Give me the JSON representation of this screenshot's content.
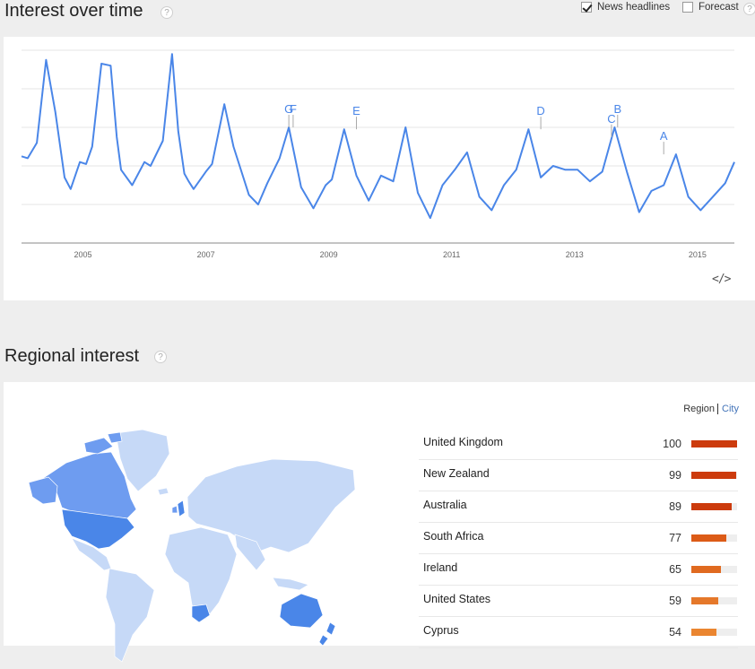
{
  "interest": {
    "title": "Interest over time",
    "help_icon": "?",
    "news_label": "News headlines",
    "news_checked": true,
    "forecast_label": "Forecast",
    "forecast_checked": false,
    "embed_icon": "</>"
  },
  "chart_data": {
    "type": "line",
    "x_ticks": [
      "2005",
      "2007",
      "2009",
      "2011",
      "2013",
      "2015"
    ],
    "x_range": [
      2004.0,
      2015.6
    ],
    "y_range": [
      0,
      100
    ],
    "grid": true,
    "series_color": "#4a86e8",
    "x": [
      2004.0,
      2004.1,
      2004.25,
      2004.4,
      2004.55,
      2004.7,
      2004.8,
      2004.95,
      2005.05,
      2005.15,
      2005.3,
      2005.45,
      2005.55,
      2005.62,
      2005.8,
      2006.0,
      2006.1,
      2006.3,
      2006.45,
      2006.55,
      2006.65,
      2006.72,
      2006.8,
      2007.0,
      2007.1,
      2007.3,
      2007.45,
      2007.7,
      2007.85,
      2008.0,
      2008.2,
      2008.35,
      2008.55,
      2008.75,
      2008.95,
      2009.05,
      2009.25,
      2009.45,
      2009.65,
      2009.85,
      2010.05,
      2010.25,
      2010.45,
      2010.65,
      2010.85,
      2011.05,
      2011.25,
      2011.45,
      2011.65,
      2011.85,
      2012.05,
      2012.25,
      2012.45,
      2012.65,
      2012.85,
      2013.05,
      2013.25,
      2013.45,
      2013.65,
      2013.85,
      2014.05,
      2014.25,
      2014.45,
      2014.65,
      2014.85,
      2015.05,
      2015.25,
      2015.45,
      2015.6
    ],
    "y": [
      45,
      44,
      52,
      95,
      68,
      34,
      28,
      42,
      41,
      50,
      93,
      92,
      55,
      38,
      30,
      42,
      40,
      53,
      98,
      58,
      36,
      32,
      28,
      37,
      41,
      72,
      50,
      25,
      20,
      31,
      44,
      60,
      29,
      18,
      30,
      33,
      59,
      35,
      22,
      35,
      32,
      60,
      26,
      13,
      30,
      38,
      47,
      24,
      17,
      30,
      38,
      59,
      34,
      40,
      38,
      38,
      32,
      37,
      60,
      37,
      16,
      27,
      30,
      46,
      24,
      17,
      24,
      31,
      42
    ],
    "markers": [
      {
        "label": "A",
        "x": 2014.45,
        "y": 46
      },
      {
        "label": "B",
        "x": 2013.7,
        "y": 60
      },
      {
        "label": "C",
        "x": 2013.6,
        "y": 55
      },
      {
        "label": "D",
        "x": 2012.45,
        "y": 59
      },
      {
        "label": "E",
        "x": 2009.45,
        "y": 59
      },
      {
        "label": "F",
        "x": 2008.42,
        "y": 60
      },
      {
        "label": "G",
        "x": 2008.35,
        "y": 60
      }
    ]
  },
  "regional": {
    "title": "Regional interest",
    "help_icon": "?",
    "toggle_region": "Region",
    "toggle_city": "City",
    "rows": [
      {
        "name": "United Kingdom",
        "value": "100",
        "pct": 100,
        "color": "#cc3b0d"
      },
      {
        "name": "New Zealand",
        "value": "99",
        "pct": 99,
        "color": "#cc3b0d"
      },
      {
        "name": "Australia",
        "value": "89",
        "pct": 89,
        "color": "#cc3b0d"
      },
      {
        "name": "South Africa",
        "value": "77",
        "pct": 77,
        "color": "#dc5b17"
      },
      {
        "name": "Ireland",
        "value": "65",
        "pct": 65,
        "color": "#e06a20"
      },
      {
        "name": "United States",
        "value": "59",
        "pct": 59,
        "color": "#e5782a"
      },
      {
        "name": "Cyprus",
        "value": "54",
        "pct": 54,
        "color": "#ea8530"
      }
    ],
    "map_colors": {
      "high": "#4a86e8",
      "mid": "#6e9cf0",
      "low": "#c6d9f7",
      "border": "#ffffff"
    }
  }
}
